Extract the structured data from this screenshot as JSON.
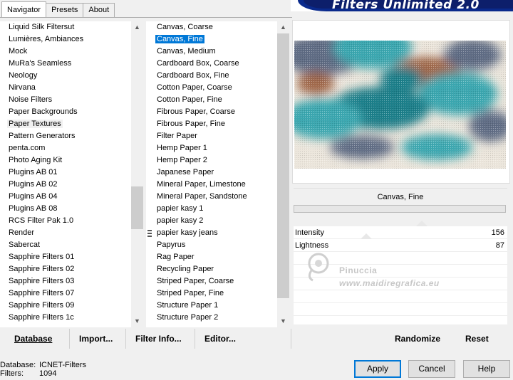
{
  "tabs": [
    "Navigator",
    "Presets",
    "About"
  ],
  "banner_title": "Filters Unlimited 2.0",
  "categories": [
    "Liquid Silk Filtersut",
    "Lumières, Ambiances",
    "Mock",
    "MuRa's Seamless",
    "Neology",
    "Nirvana",
    "Noise Filters",
    "Paper Backgrounds",
    "Paper Textures",
    "Pattern Generators",
    "penta.com",
    "Photo Aging Kit",
    "Plugins AB 01",
    "Plugins AB 02",
    "Plugins AB 04",
    "Plugins AB 08",
    "RCS Filter Pak 1.0",
    "Render",
    "Sabercat",
    "Sapphire Filters 01",
    "Sapphire Filters 02",
    "Sapphire Filters 03",
    "Sapphire Filters 07",
    "Sapphire Filters 09",
    "Sapphire Filters 1c"
  ],
  "selected_category": "Paper Textures",
  "filters": [
    "Canvas, Coarse",
    "Canvas, Fine",
    "Canvas, Medium",
    "Cardboard Box, Coarse",
    "Cardboard Box, Fine",
    "Cotton Paper, Coarse",
    "Cotton Paper, Fine",
    "Fibrous Paper, Coarse",
    "Fibrous Paper, Fine",
    "Filter Paper",
    "Hemp Paper 1",
    "Hemp Paper 2",
    "Japanese Paper",
    "Mineral Paper, Limestone",
    "Mineral Paper, Sandstone",
    "papier kasy 1",
    "papier kasy 2",
    "papier kasy jeans",
    "Papyrus",
    "Rag Paper",
    "Recycling Paper",
    "Striped Paper, Coarse",
    "Striped Paper, Fine",
    "Structure Paper 1",
    "Structure Paper 2"
  ],
  "selected_filter": "Canvas, Fine",
  "left_scroll_position": 0.64,
  "preview_colors": {
    "teal": "#3aa7b0",
    "dark_teal": "#1f7f8a",
    "brown": "#a0684a",
    "slate": "#5e6c84",
    "cream": "#ece6dc"
  },
  "current_filter_label": "Canvas, Fine",
  "params": [
    {
      "label": "Intensity",
      "value": "156"
    },
    {
      "label": "Lightness",
      "value": "87"
    }
  ],
  "watermark": {
    "name": "Pinuccia",
    "url": "www.maidiregrafica.eu"
  },
  "toolbar": {
    "database": "Database",
    "import": "Import...",
    "filter_info": "Filter Info...",
    "editor": "Editor...",
    "randomize": "Randomize",
    "reset": "Reset"
  },
  "status": {
    "db_key": "Database:",
    "db_value": "ICNET-Filters",
    "f_key": "Filters:",
    "f_value": "1094"
  },
  "buttons": {
    "apply": "Apply",
    "cancel": "Cancel",
    "help": "Help"
  }
}
